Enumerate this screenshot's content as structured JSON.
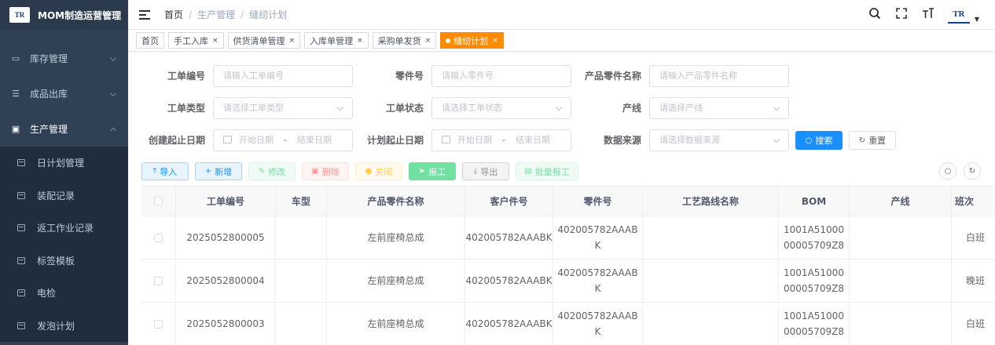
{
  "app": {
    "logo_text": "TR",
    "title": "MOM制造运营管理"
  },
  "sidebar": {
    "items": [
      {
        "label": "库存管理",
        "icon": "monitor-icon",
        "expanded": false
      },
      {
        "label": "成品出库",
        "icon": "list-icon",
        "expanded": false
      },
      {
        "label": "生产管理",
        "icon": "production-icon",
        "expanded": true
      }
    ],
    "subitems": [
      {
        "label": "日计划管理"
      },
      {
        "label": "装配记录"
      },
      {
        "label": "返工作业记录"
      },
      {
        "label": "标签模板"
      },
      {
        "label": "电检"
      },
      {
        "label": "发泡计划"
      }
    ]
  },
  "header": {
    "breadcrumb": [
      "首页",
      "生产管理",
      "缝纫计划"
    ],
    "avatar_text": "TR"
  },
  "tags": [
    {
      "label": "首页",
      "closable": false,
      "active": false
    },
    {
      "label": "手工入库",
      "closable": true,
      "active": false
    },
    {
      "label": "供货清单管理",
      "closable": true,
      "active": false
    },
    {
      "label": "入库单管理",
      "closable": true,
      "active": false
    },
    {
      "label": "采购单发货",
      "closable": true,
      "active": false
    },
    {
      "label": "缝纫计划",
      "closable": true,
      "active": true
    }
  ],
  "form": {
    "work_order_no": {
      "label": "工单编号",
      "placeholder": "请输入工单编号"
    },
    "part_no": {
      "label": "零件号",
      "placeholder": "请输入零件号"
    },
    "product_part_name": {
      "label": "产品零件名称",
      "placeholder": "请输入产品零件名称"
    },
    "work_order_type": {
      "label": "工单类型",
      "placeholder": "请选择工单类型"
    },
    "work_order_status": {
      "label": "工单状态",
      "placeholder": "请选择工单状态"
    },
    "line": {
      "label": "产线",
      "placeholder": "请选择产线"
    },
    "create_date": {
      "label": "创建起止日期",
      "start": "开始日期",
      "end": "结束日期",
      "sep": "-"
    },
    "plan_date": {
      "label": "计划起止日期",
      "start": "开始日期",
      "end": "结束日期",
      "sep": "-"
    },
    "data_source": {
      "label": "数据来源",
      "placeholder": "请选择数据来源"
    },
    "search_label": "搜索",
    "reset_label": "重置"
  },
  "toolbar": {
    "import": "导入",
    "add": "新增",
    "edit": "修改",
    "delete": "删除",
    "close": "关闭",
    "report": "报工",
    "export": "导出",
    "batch_report": "批量报工"
  },
  "table": {
    "columns": [
      "工单编号",
      "车型",
      "产品零件名称",
      "客户件号",
      "零件号",
      "工艺路线名称",
      "BOM",
      "产线",
      "班次"
    ],
    "rows": [
      {
        "work_order_no": "2025052800005",
        "model": "",
        "product_name": "左前座椅总成",
        "customer_part_no": "402005782AAABK",
        "part_no_1": "402005782AAAB",
        "part_no_2": "K",
        "route": "",
        "bom_1": "1001A51000",
        "bom_2": "00005709Z8",
        "line": "",
        "shift": "白班"
      },
      {
        "work_order_no": "2025052800004",
        "model": "",
        "product_name": "左前座椅总成",
        "customer_part_no": "402005782AAABK",
        "part_no_1": "402005782AAAB",
        "part_no_2": "K",
        "route": "",
        "bom_1": "1001A51000",
        "bom_2": "00005709Z8",
        "line": "",
        "shift": "晚班"
      },
      {
        "work_order_no": "2025052800003",
        "model": "",
        "product_name": "左前座椅总成",
        "customer_part_no": "402005782AAABK",
        "part_no_1": "402005782AAAB",
        "part_no_2": "K",
        "route": "",
        "bom_1": "1001A51000",
        "bom_2": "00005709Z8",
        "line": "",
        "shift": "白班"
      }
    ]
  },
  "colors": {
    "sidebar_bg": "#304156",
    "submenu_bg": "#1f2d3d",
    "active_tag": "#ff8c00",
    "primary": "#1890ff"
  }
}
